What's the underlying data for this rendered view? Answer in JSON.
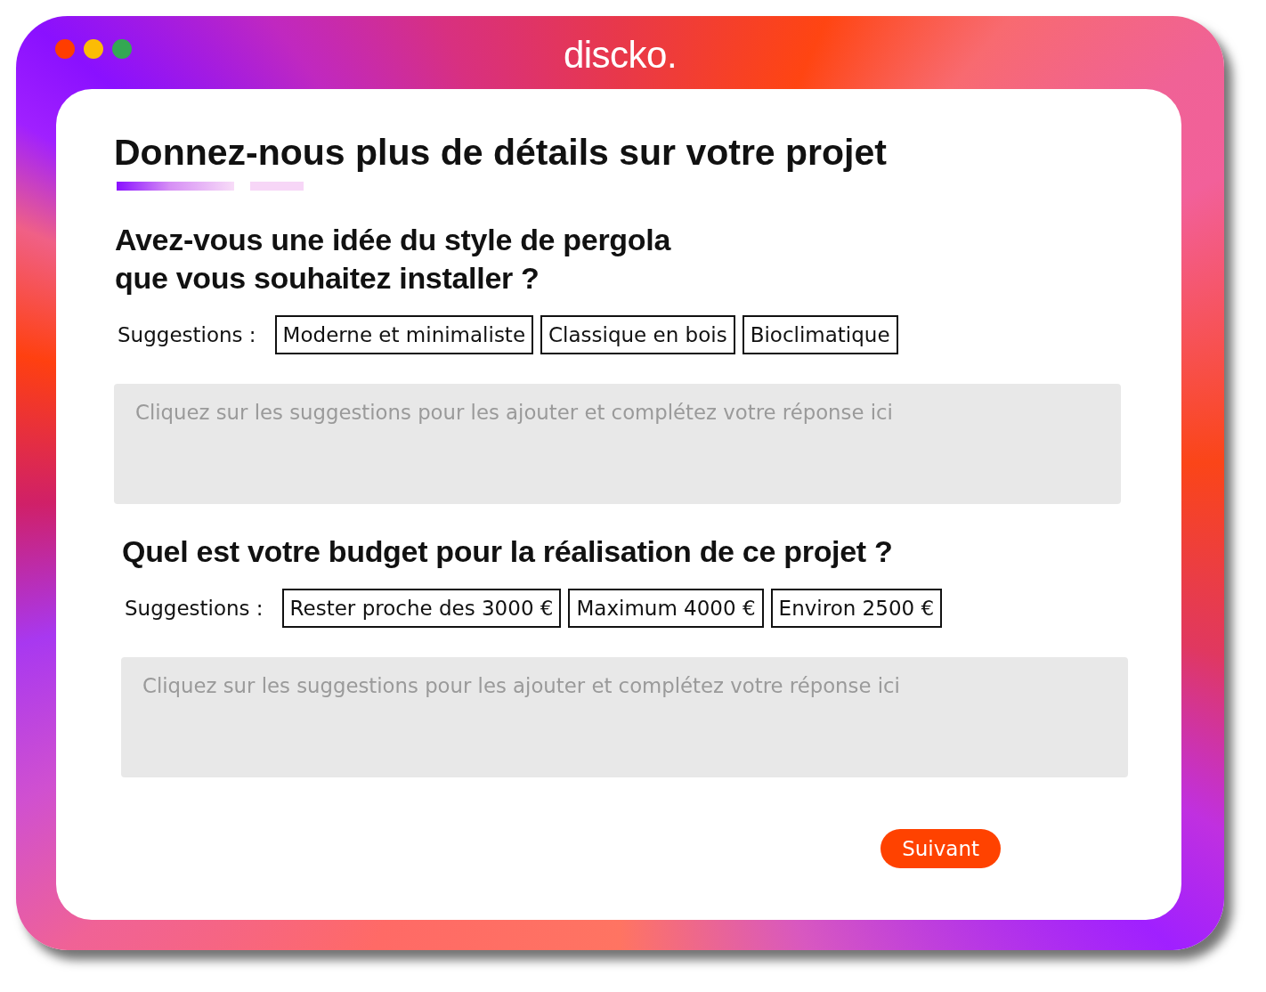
{
  "window": {
    "logo": "discko."
  },
  "page": {
    "title": "Donnez-nous plus de détails sur votre projet",
    "steps": [
      {
        "active": true
      },
      {
        "active": false
      }
    ]
  },
  "questions": [
    {
      "question": "Avez-vous une idée du style de pergola\nque vous souhaitez installer ?",
      "suggestions_label": "Suggestions :",
      "suggestions": [
        "Moderne et minimaliste",
        "Classique en bois",
        "Bioclimatique"
      ],
      "answer": {
        "placeholder": "Cliquez sur les suggestions pour les ajouter et complétez votre réponse ici"
      }
    },
    {
      "question": "Quel est votre budget pour la réalisation de ce projet ?",
      "suggestions_label": "Suggestions :",
      "suggestions": [
        "Rester proche des 3000 €",
        "Maximum 4000 €",
        "Environ 2500 €"
      ],
      "answer": {
        "placeholder": "Cliquez sur les suggestions pour les ajouter et complétez votre réponse ici"
      }
    }
  ],
  "next_button": "Suivant"
}
